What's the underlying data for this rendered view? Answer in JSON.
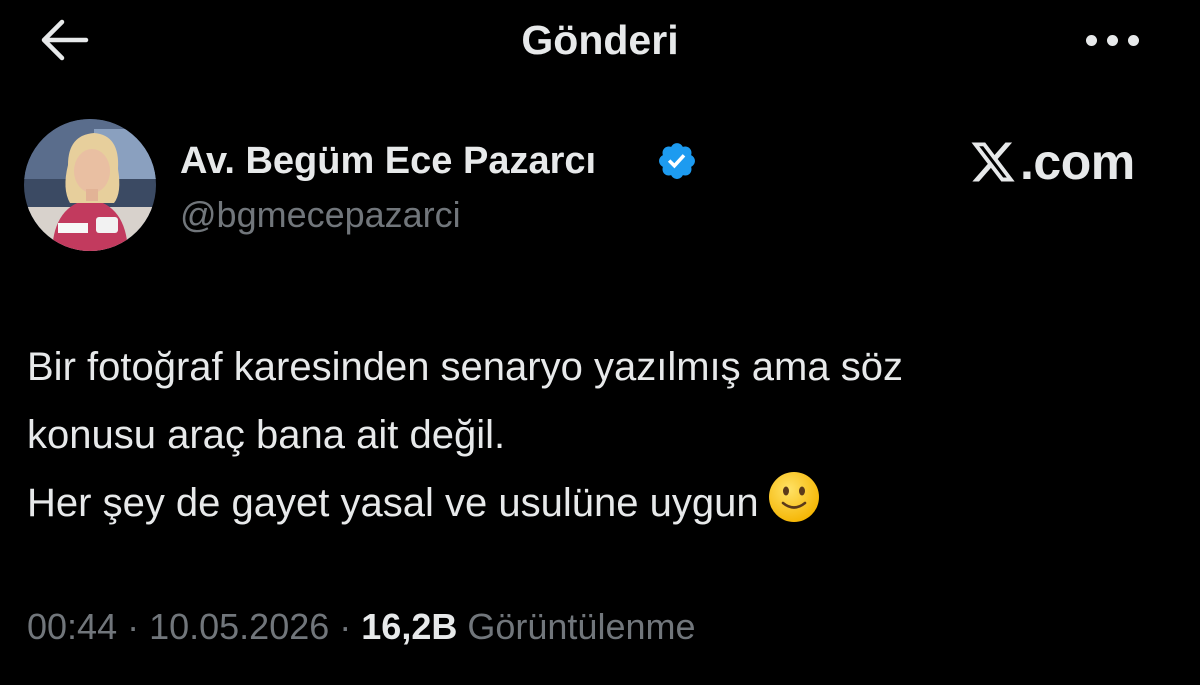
{
  "header": {
    "title": "Gönderi",
    "back_icon": "arrow-left-icon",
    "more_icon": "more-horizontal-icon"
  },
  "author": {
    "display_name": "Av. Begüm Ece Pazarcı",
    "handle": "@bgmecepazarci",
    "verified": true,
    "verified_icon": "verified-badge-icon",
    "verified_color": "#1d9bf0"
  },
  "watermark": {
    "text": ".com",
    "logo_icon": "x-logo-icon"
  },
  "tweet": {
    "lines": [
      "Bir fotoğraf karesinden senaryo yazılmış ama söz",
      "konusu araç bana ait değil.",
      "Her şey de gayet yasal ve usulüne uygun"
    ],
    "emoji": "slightly-smiling-face-icon"
  },
  "meta": {
    "time": "00:44",
    "separator": " · ",
    "date": "10.05.2026",
    "views_count": "16,2B",
    "views_label": "Görüntülenme"
  },
  "colors": {
    "background": "#000000",
    "primary_text": "#e7e9ea",
    "secondary_text": "#71767b"
  }
}
